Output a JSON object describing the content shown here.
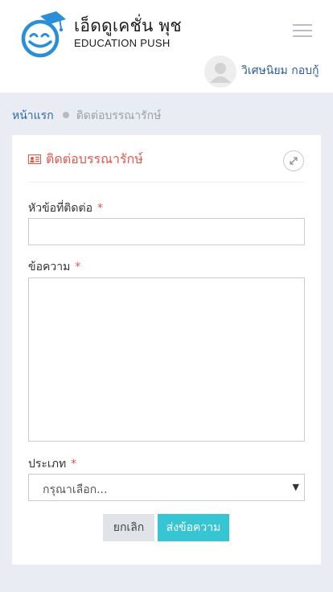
{
  "brand": {
    "name_th": "เอ็ดดูเคชั่น พุช",
    "name_en": "EDUCATION PUSH"
  },
  "header": {
    "user_name": "วิเศษนิยม กอบกู้"
  },
  "breadcrumb": {
    "home": "หน้าแรก",
    "current": "ติดต่อบรรณารักษ์"
  },
  "form": {
    "title": "ติดต่อบรรณารักษ์",
    "required_mark": "*",
    "subject": {
      "label": "หัวข้อที่ติดต่อ",
      "value": ""
    },
    "message": {
      "label": "ข้อความ",
      "value": ""
    },
    "category": {
      "label": "ประเภท",
      "selected": "กรุณาเลือก..."
    },
    "cancel_label": "ยกเลิก",
    "submit_label": "ส่งข้อความ"
  },
  "colors": {
    "accent_red": "#e0574b",
    "submit_cyan": "#36c6d3",
    "link_blue": "#2f6aa8",
    "page_bg": "#e9edf3"
  },
  "icons": [
    "logo-smiley-graduation-icon",
    "hamburger-menu-icon",
    "user-avatar-icon",
    "contact-card-icon",
    "expand-icon",
    "chevron-down-icon"
  ]
}
